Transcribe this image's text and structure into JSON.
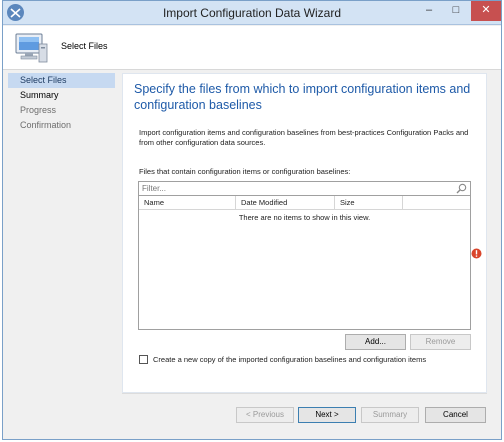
{
  "window": {
    "title": "Import Configuration Data Wizard",
    "minimize_glyph": "–",
    "maximize_glyph": "□",
    "close_glyph": "✕",
    "app_icon": "sccm-console-icon"
  },
  "header": {
    "title": "Select Files",
    "icon": "computer-icon"
  },
  "nav": {
    "items": [
      {
        "label": "Select Files",
        "state": "active"
      },
      {
        "label": "Summary",
        "state": "normal"
      },
      {
        "label": "Progress",
        "state": "dim"
      },
      {
        "label": "Confirmation",
        "state": "dim"
      }
    ]
  },
  "main": {
    "heading": "Specify the files from which to import configuration items and configuration baselines",
    "description": "Import configuration items and configuration baselines from best-practices Configuration Packs and from other configuration data sources.",
    "files_label": "Files that contain configuration items or configuration baselines:",
    "filter": {
      "placeholder": "Filter...",
      "value": ""
    },
    "table": {
      "columns": [
        "Name",
        "Date Modified",
        "Size"
      ],
      "rows": [],
      "empty_message": "There are no items to show in this view."
    },
    "add_label": "Add...",
    "remove_label": "Remove",
    "checkbox": {
      "label": "Create a new copy of the imported configuration baselines and configuration items",
      "checked": false
    }
  },
  "footer": {
    "previous_label": "< Previous",
    "next_label": "Next >",
    "summary_label": "Summary",
    "close_label": "Cancel"
  },
  "colors": {
    "heading": "#1e5aa8",
    "nav_active": "#c6d9f1",
    "titlebar": "#d3e3f4",
    "warning": "#d9452b"
  }
}
